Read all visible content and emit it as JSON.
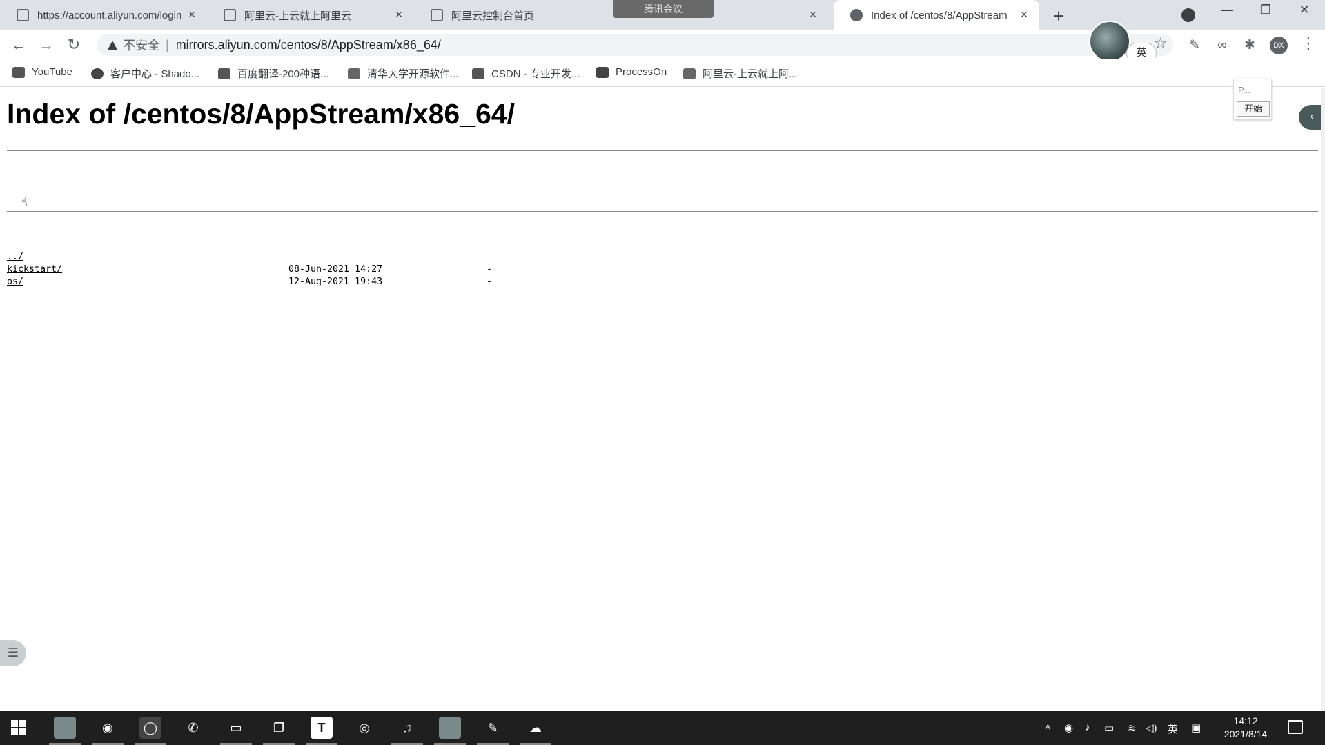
{
  "tabs": [
    {
      "title": "https://account.aliyun.com/login",
      "close": "×"
    },
    {
      "title": "阿里云-上云就上阿里云",
      "close": "×"
    },
    {
      "title": "阿里云控制台首页",
      "close": "×"
    },
    {
      "title": "Index of /centos/8/AppStream",
      "close": "×",
      "active": true
    }
  ],
  "overlay": {
    "meeting": "腾讯会议"
  },
  "new_tab": "+",
  "window": {
    "minimize": "—",
    "restore": "❐",
    "close": "✕"
  },
  "toolbar": {
    "back": "←",
    "forward": "→",
    "reload": "↻",
    "insecure_label": "不安全",
    "separator": "|",
    "url": "mirrors.aliyun.com/centos/8/AppStream/x86_64/",
    "star": "☆",
    "profile": "DX",
    "menu": "⋮",
    "ime_badge": "英"
  },
  "bookmarks": [
    {
      "label": "YouTube",
      "color": "#555555"
    },
    {
      "label": "客户中心 - Shado...",
      "color": "#444444"
    },
    {
      "label": "百度翻译-200种语...",
      "color": "#555555"
    },
    {
      "label": "清华大学开源软件...",
      "color": "#666666"
    },
    {
      "label": "CSDN - 专业开发...",
      "color": "#555555"
    },
    {
      "label": "ProcessOn",
      "color": "#444444"
    },
    {
      "label": "阿里云-上云就上阿...",
      "color": "#666666"
    }
  ],
  "page": {
    "heading": "Index of /centos/8/AppStream/x86_64/",
    "entries": [
      {
        "name": "../",
        "date": "",
        "size": ""
      },
      {
        "name": "kickstart/",
        "date": "08-Jun-2021 14:27",
        "size": "-"
      },
      {
        "name": "os/",
        "date": "12-Aug-2021 19:43",
        "size": "-"
      }
    ]
  },
  "popup": {
    "placeholder": "P...",
    "start": "开始"
  },
  "side_tab": "‹",
  "taskbar": {
    "time": "14:12",
    "date": "2021/8/14",
    "ime": "英"
  }
}
